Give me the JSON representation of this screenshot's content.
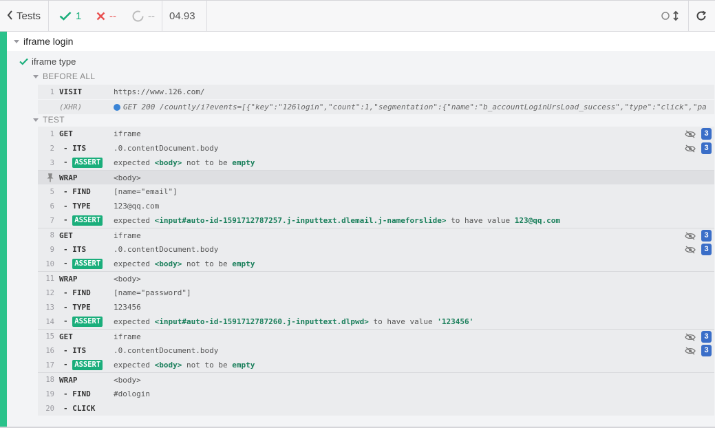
{
  "header": {
    "back_label": "Tests",
    "passed": "1",
    "failed": "--",
    "pending": "--",
    "duration": "04.93"
  },
  "suite": {
    "title": "iframe login"
  },
  "test": {
    "title": "iframe type"
  },
  "sections": {
    "before_all": "BEFORE ALL",
    "test": "TEST"
  },
  "colors": {
    "passed": "#1aae7b",
    "failed": "#e94f4f",
    "accent_green": "#2ac28b",
    "badge_blue": "#3a6ec8",
    "xhr_dot": "#3a84d6"
  },
  "icons": {
    "eye": "eye-slash-icon",
    "pin": "pin-icon",
    "check": "check-icon",
    "x": "x-icon",
    "spinner": "pending-circle-icon",
    "reload": "reload-icon",
    "scroll": "auto-scroll-icon"
  },
  "before_all": [
    {
      "num": "1",
      "method": "VISIT",
      "message": "https://www.126.com/"
    },
    {
      "num": "",
      "method": "(XHR)",
      "message": "GET 200 /countly/i?events=[{\"key\":\"126login\",\"count\":1,\"segmentation\":{\"name\":\"b_accountLoginUrsLoad_success\",\"type\":\"click\",\"pa"
    }
  ],
  "commands": [
    {
      "num": "1",
      "method": "GET",
      "message": "iframe",
      "count": "3"
    },
    {
      "num": "2",
      "method": "- ITS",
      "message": ".0.contentDocument.body",
      "count": "3"
    },
    {
      "num": "3",
      "assert_prefix": "- ",
      "assert_label": "ASSERT",
      "expected": "expected",
      "subject": "<body>",
      "relation": "not to be",
      "value": "empty"
    },
    {
      "num": "",
      "method": "WRAP",
      "message": "<body>"
    },
    {
      "num": "5",
      "method": "- FIND",
      "message": "[name=\"email\"]"
    },
    {
      "num": "6",
      "method": "- TYPE",
      "message": "123@qq.com"
    },
    {
      "num": "7",
      "assert_prefix": "- ",
      "assert_label": "ASSERT",
      "expected": "expected",
      "subject": "<input#auto-id-1591712787257.j-inputtext.dlemail.j-nameforslide>",
      "relation": "to have value",
      "value": "123@qq.com"
    },
    {
      "num": "8",
      "method": "GET",
      "message": "iframe",
      "count": "3"
    },
    {
      "num": "9",
      "method": "- ITS",
      "message": ".0.contentDocument.body",
      "count": "3"
    },
    {
      "num": "10",
      "assert_prefix": "- ",
      "assert_label": "ASSERT",
      "expected": "expected",
      "subject": "<body>",
      "relation": "not to be",
      "value": "empty"
    },
    {
      "num": "11",
      "method": "WRAP",
      "message": "<body>"
    },
    {
      "num": "12",
      "method": "- FIND",
      "message": "[name=\"password\"]"
    },
    {
      "num": "13",
      "method": "- TYPE",
      "message": "123456"
    },
    {
      "num": "14",
      "assert_prefix": "- ",
      "assert_label": "ASSERT",
      "expected": "expected",
      "subject": "<input#auto-id-1591712787260.j-inputtext.dlpwd>",
      "relation": "to have value",
      "value": "'123456'"
    },
    {
      "num": "15",
      "method": "GET",
      "message": "iframe",
      "count": "3"
    },
    {
      "num": "16",
      "method": "- ITS",
      "message": ".0.contentDocument.body",
      "count": "3"
    },
    {
      "num": "17",
      "assert_prefix": "- ",
      "assert_label": "ASSERT",
      "expected": "expected",
      "subject": "<body>",
      "relation": "not to be",
      "value": "empty"
    },
    {
      "num": "18",
      "method": "WRAP",
      "message": "<body>"
    },
    {
      "num": "19",
      "method": "- FIND",
      "message": "#dologin"
    },
    {
      "num": "20",
      "method": "- CLICK",
      "message": ""
    }
  ]
}
